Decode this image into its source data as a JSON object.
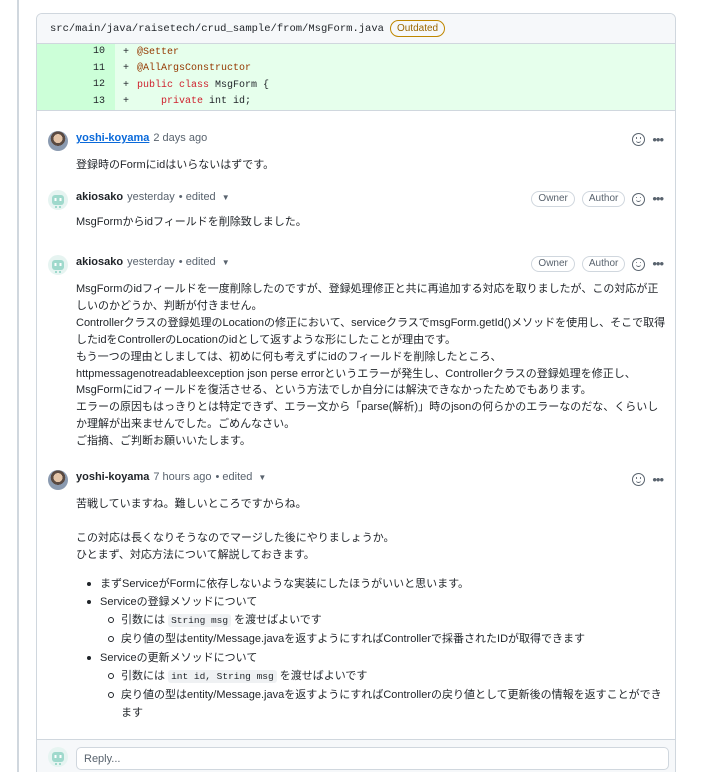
{
  "file": {
    "path": "src/main/java/raisetech/crud_sample/from/MsgForm.java",
    "badge": "Outdated"
  },
  "diff": {
    "lines": [
      {
        "num": "10",
        "sign": "+",
        "code": "@Setter"
      },
      {
        "num": "11",
        "sign": "+",
        "code": "@AllArgsConstructor"
      },
      {
        "num": "12",
        "sign": "+",
        "kw": "public class",
        "rest": " MsgForm {"
      },
      {
        "num": "13",
        "sign": "+",
        "indent": "    ",
        "kw": "private",
        "rest": " int id;"
      }
    ]
  },
  "comments": [
    {
      "author": "yoshi-koyama",
      "time": "2 days ago",
      "edited": "",
      "badges": [],
      "body": [
        "登録時のFormにidはいらないはずです。"
      ]
    },
    {
      "author": "akiosako",
      "time": "yesterday",
      "edited": "• edited",
      "badges": [
        "Owner",
        "Author"
      ],
      "body": [
        "MsgFormからidフィールドを削除致しました。"
      ]
    },
    {
      "author": "akiosako",
      "time": "yesterday",
      "edited": "• edited",
      "badges": [
        "Owner",
        "Author"
      ],
      "body": [
        "MsgFormのidフィールドを一度削除したのですが、登録処理修正と共に再追加する対応を取りましたが、この対応が正しいのかどうか、判断が付きません。",
        "Controllerクラスの登録処理のLocationの修正において、serviceクラスでmsgForm.getId()メソッドを使用し、そこで取得したidをControllerのLocationのidとして返すような形にしたことが理由です。",
        "もう一つの理由としましては、初めに何も考えずにidのフィールドを削除したところ、httpmessagenotreadableexception json perse errorというエラーが発生し、Controllerクラスの登録処理を修正し、MsgFormにidフィールドを復活させる、という方法でしか自分には解決できなかったためでもあります。",
        "エラーの原因もはっきりとは特定できず、エラー文から「parse(解析)」時のjsonの何らかのエラーなのだな、くらいしか理解が出来ませんでした。ごめんなさい。",
        "ご指摘、ご判断お願いいたします。"
      ]
    },
    {
      "author": "yoshi-koyama",
      "time": "7 hours ago",
      "edited": "• edited",
      "badges": [],
      "body": [
        "苦戦していますね。難しいところですからね。",
        "この対応は長くなりそうなのでマージした後にやりましょうか。",
        "ひとまず、対応方法について解説しておきます。"
      ],
      "list": {
        "item1": "まずServiceがFormに依存しないような実装にしたほうがいいと思います。",
        "item2": "Serviceの登録メソッドについて",
        "item2_sub1_pre": "引数には ",
        "item2_sub1_code": "String msg",
        "item2_sub1_post": " を渡せばよいです",
        "item2_sub2": "戻り値の型はentity/Message.javaを返すようにすればControllerで採番されたIDが取得できます",
        "item3": "Serviceの更新メソッドについて",
        "item3_sub1_pre": "引数には ",
        "item3_sub1_code": "int id, String msg",
        "item3_sub1_post": " を渡せばよいです",
        "item3_sub2": "戻り値の型はentity/Message.javaを返すようにすればControllerの戻り値として更新後の情報を返すことができます"
      }
    }
  ],
  "reply": {
    "placeholder": "Reply..."
  },
  "icons": {
    "smiley": "smiley-icon",
    "kebab": "kebab-horizontal-icon",
    "caret": "triangle-down-icon"
  }
}
